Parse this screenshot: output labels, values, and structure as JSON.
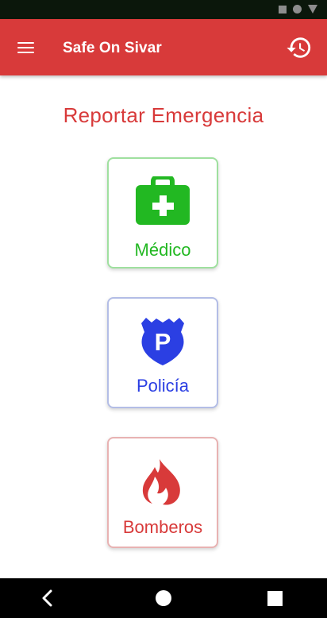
{
  "app": {
    "title": "Safe On Sivar"
  },
  "icons": {
    "menu": "menu-icon",
    "history": "history-icon",
    "medical": "medical-kit-icon",
    "police": "police-badge-icon",
    "fire": "fire-icon"
  },
  "main": {
    "heading": "Reportar Emergencia",
    "options": [
      {
        "label": "Médico",
        "color": "#22b822"
      },
      {
        "label": "Policía",
        "color": "#2b3fe3"
      },
      {
        "label": "Bomberos",
        "color": "#d83a3a"
      }
    ]
  },
  "police_badge_letter": "P",
  "colors": {
    "app_bar": "#d83a3a",
    "status_bar": "#0b170b",
    "nav_bar": "#000000"
  }
}
